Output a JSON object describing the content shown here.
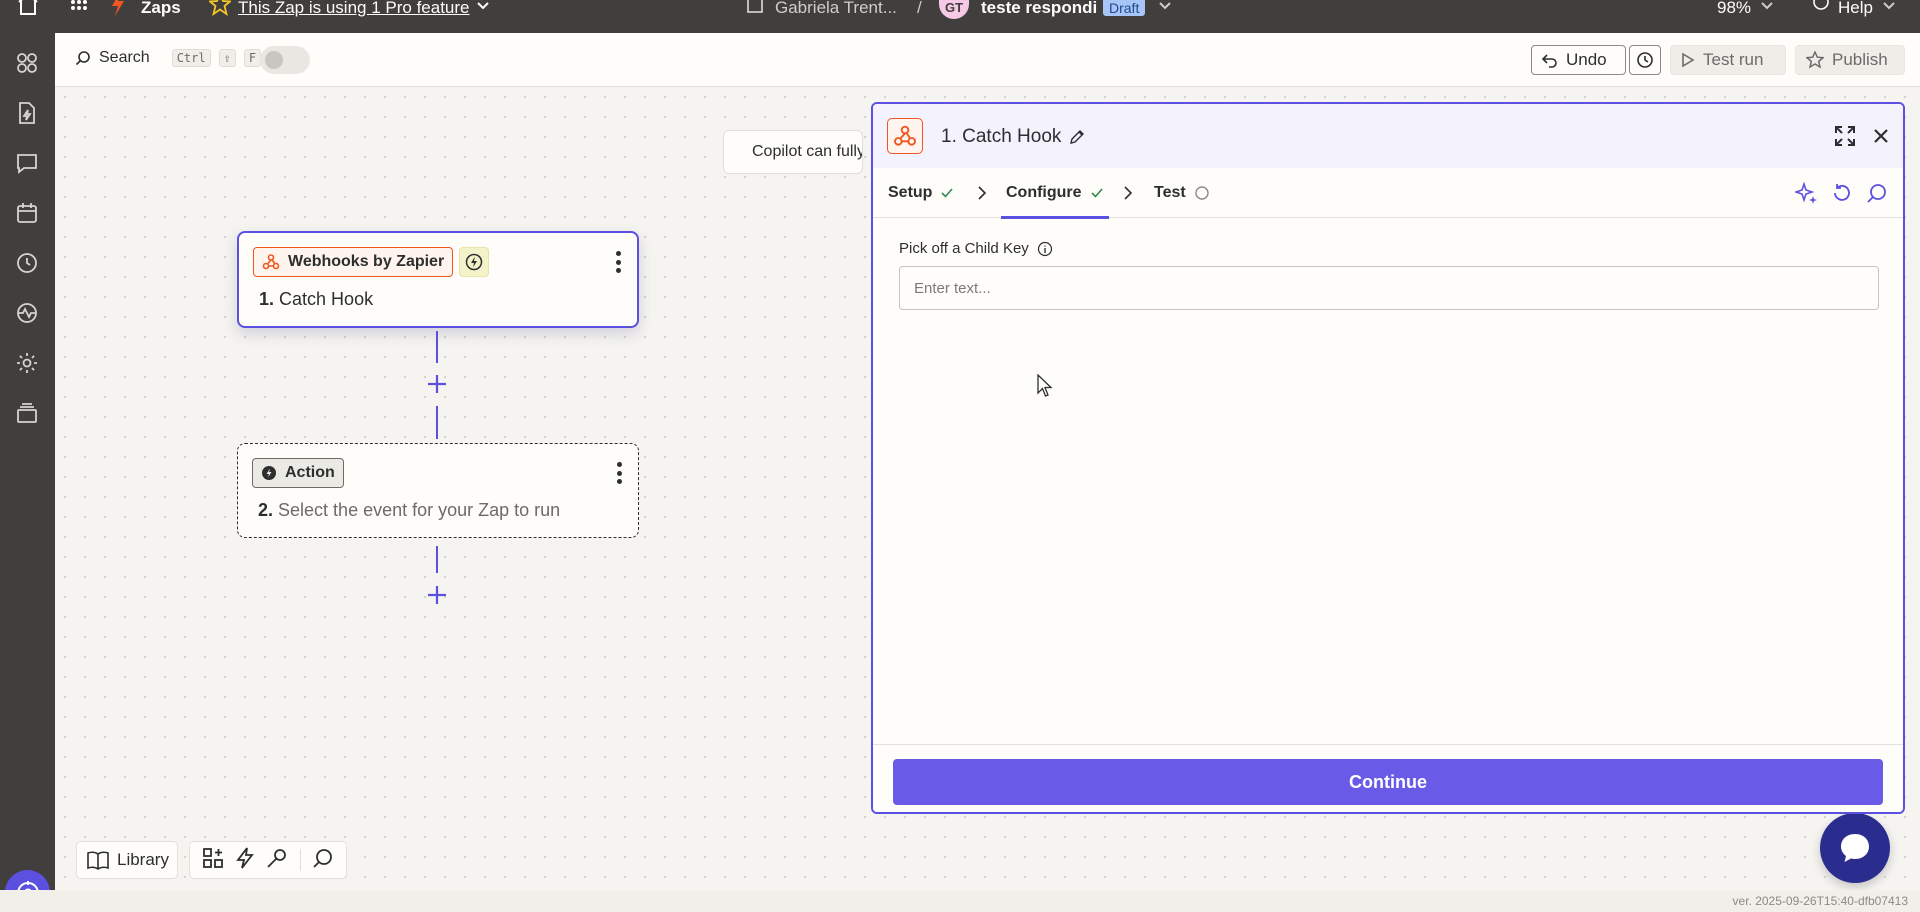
{
  "topbar": {
    "app_name": "Zaps",
    "pro_feature": "This Zap is using 1 Pro feature",
    "owner": "Gabriela Trent...",
    "path_sep": "/",
    "avatar_initials": "GT",
    "zap_name": "teste respondi",
    "status": "Draft",
    "zoom": "98%",
    "help": "Help"
  },
  "toolbar": {
    "search_label": "Search",
    "shortcut_ctrl": "Ctrl",
    "shortcut_shift": "⇧",
    "shortcut_key": "F",
    "undo_label": "Undo",
    "test_run_label": "Test run",
    "publish_label": "Publish"
  },
  "canvas": {
    "copilot_text": "Copilot can fully build your Zap",
    "trigger": {
      "app": "Webhooks by Zapier",
      "number": "1.",
      "title": "Catch Hook"
    },
    "action": {
      "badge": "Action",
      "number": "2.",
      "title": "Select the event for your Zap to run"
    }
  },
  "bottom_toolbar": {
    "library_label": "Library"
  },
  "panel": {
    "title": "1. Catch Hook",
    "tabs": [
      {
        "label": "Setup",
        "state": "complete"
      },
      {
        "label": "Configure",
        "state": "complete"
      },
      {
        "label": "Test",
        "state": "pending"
      }
    ],
    "field": {
      "label": "Pick off a Child Key",
      "value": "",
      "placeholder": "Enter text..."
    },
    "continue_label": "Continue"
  },
  "version": "ver. 2025-09-26T15:40-dfb07413",
  "colors": {
    "accent": "#5b50e0",
    "button": "#695be8",
    "zapier_orange": "#f0561e",
    "topbar": "#403f3e",
    "success": "#2e8a4d"
  }
}
